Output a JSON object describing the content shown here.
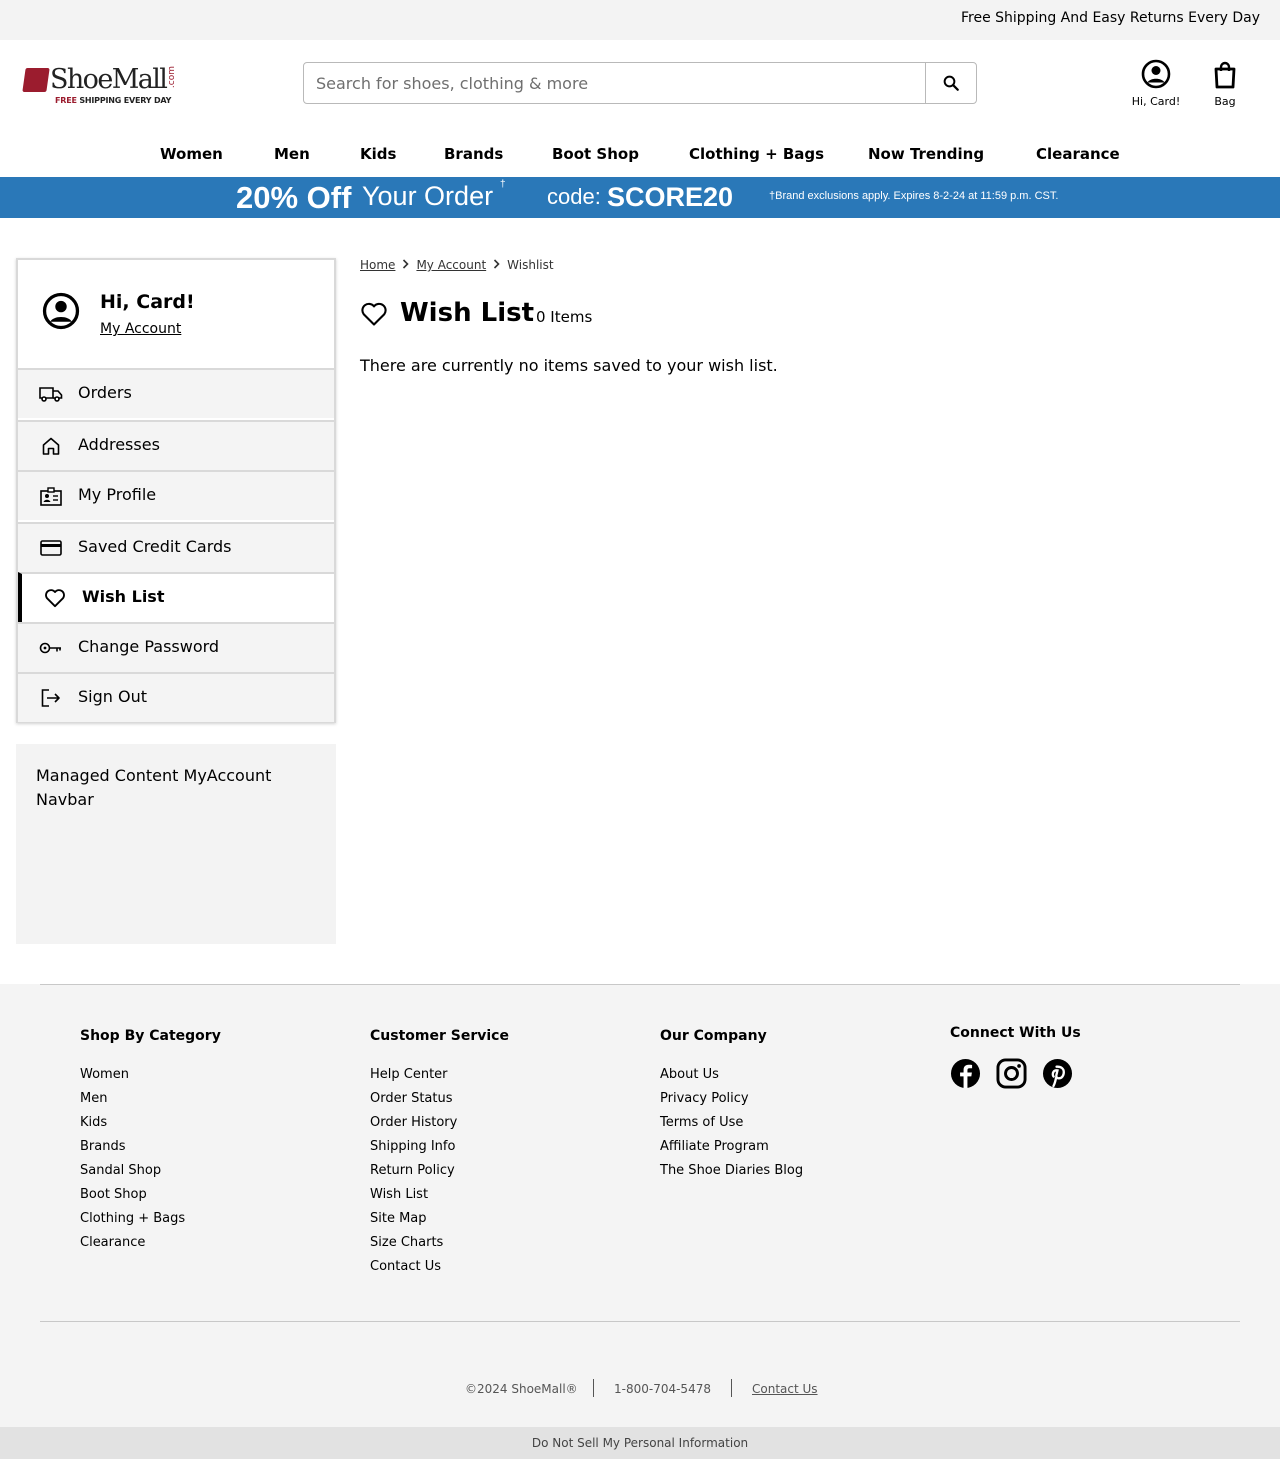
{
  "topbar": {
    "text": "Free Shipping And Easy Returns Every Day"
  },
  "logo": {
    "word": "ShoeMall",
    "dotcom": ".com",
    "free": "FREE",
    "tagline_rest": " SHIPPING EVERY DAY"
  },
  "search": {
    "placeholder": "Search for shoes, clothing & more",
    "value": ""
  },
  "header": {
    "account_label": "Hi, Card!",
    "bag_label": "Bag"
  },
  "nav": [
    "Women",
    "Men",
    "Kids",
    "Brands",
    "Boot Shop",
    "Clothing + Bags",
    "Now Trending",
    "Clearance"
  ],
  "promo": {
    "headline": "20% Off",
    "sub": "Your Order",
    "dagger": "†",
    "code_label": "code:",
    "code": "SCORE20",
    "fine_print": "†Brand exclusions apply. Expires 8-2-24 at 11:59 p.m. CST.",
    "color": "#2a78b8"
  },
  "sidebar": {
    "greeting": "Hi, Card!",
    "account_link": "My Account",
    "items": [
      {
        "label": "Orders",
        "icon": "truck-icon"
      },
      {
        "label": "Addresses",
        "icon": "home-icon"
      },
      {
        "label": "My Profile",
        "icon": "profile-card-icon"
      },
      {
        "label": "Saved Credit Cards",
        "icon": "credit-card-icon"
      },
      {
        "label": "Wish List",
        "icon": "heart-icon",
        "active": true
      },
      {
        "label": "Change Password",
        "icon": "key-icon"
      },
      {
        "label": "Sign Out",
        "icon": "sign-out-icon"
      }
    ]
  },
  "managed": {
    "text": "Managed Content MyAccount Navbar"
  },
  "breadcrumb": [
    "Home",
    "My Account",
    "Wishlist"
  ],
  "wishlist": {
    "title": "Wish List",
    "count": "0 Items",
    "empty_message": "There are currently no items saved to your wish list."
  },
  "footer": {
    "columns": [
      {
        "heading": "Shop By Category",
        "links": [
          "Women",
          "Men",
          "Kids",
          "Brands",
          "Sandal Shop",
          "Boot Shop",
          "Clothing + Bags",
          "Clearance"
        ]
      },
      {
        "heading": "Customer Service",
        "links": [
          "Help Center",
          "Order Status",
          "Order History",
          "Shipping Info",
          "Return Policy",
          "Wish List",
          "Site Map",
          "Size Charts",
          "Contact Us"
        ]
      },
      {
        "heading": "Our Company",
        "links": [
          "About Us",
          "Privacy Policy",
          "Terms of Use",
          "Affiliate Program",
          "The Shoe Diaries Blog"
        ]
      }
    ],
    "connect_heading": "Connect With Us",
    "social": [
      "facebook-icon",
      "instagram-icon",
      "pinterest-icon"
    ],
    "copyright": "©2024 ShoeMall®",
    "phone": "1-800-704-5478",
    "contact": "Contact Us",
    "do_not_sell": "Do Not Sell My Personal Information"
  }
}
